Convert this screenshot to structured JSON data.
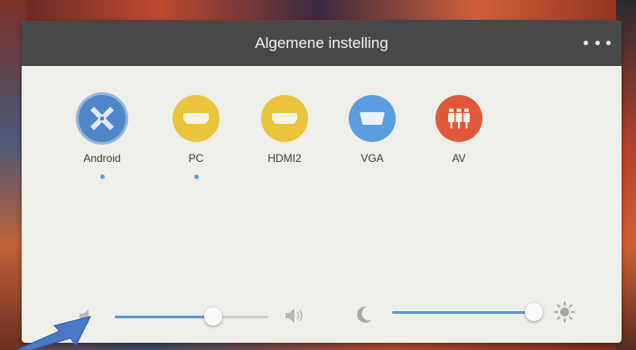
{
  "dialog": {
    "title": "Algemene instelling",
    "more_icon": "more-dots-icon"
  },
  "sources": [
    {
      "label": "Android",
      "icon": "android-x-icon",
      "color": "#4f86c8",
      "selected": true,
      "indicator": true
    },
    {
      "label": "PC",
      "icon": "hdmi-connector-icon",
      "color": "#e9c43c",
      "selected": false,
      "indicator": true
    },
    {
      "label": "HDMI2",
      "icon": "hdmi-connector-icon",
      "color": "#e9c43c",
      "selected": false,
      "indicator": false
    },
    {
      "label": "VGA",
      "icon": "vga-connector-icon",
      "color": "#5a9ee0",
      "selected": false,
      "indicator": false
    },
    {
      "label": "AV",
      "icon": "rca-connector-icon",
      "color": "#e0583a",
      "selected": false,
      "indicator": false
    }
  ],
  "volume": {
    "low_icon": "speaker-low-icon",
    "high_icon": "speaker-high-icon",
    "level": 0.64
  },
  "brightness": {
    "low_icon": "moon-icon",
    "high_icon": "sun-icon",
    "level": 0.98
  },
  "colors": {
    "accent": "#5a9ad8",
    "header_bg": "#46484a",
    "panel_bg": "#efefe9",
    "annotation_arrow": "#4a78c8"
  }
}
